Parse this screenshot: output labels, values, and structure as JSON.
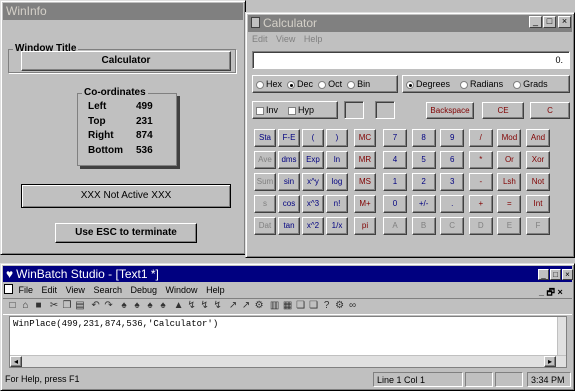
{
  "wininfo": {
    "title": "WinInfo",
    "window_title_label": "Window Title",
    "window_title_value": "Calculator",
    "coords_label": "Co-ordinates",
    "coords": [
      {
        "label": "Left",
        "value": "499"
      },
      {
        "label": "Top",
        "value": "231"
      },
      {
        "label": "Right",
        "value": "874"
      },
      {
        "label": "Bottom",
        "value": "536"
      }
    ],
    "status": "XXX Not Active XXX",
    "esc_button": "Use ESC to terminate"
  },
  "calculator": {
    "title": "Calculator",
    "menu": [
      "Edit",
      "View",
      "Help"
    ],
    "display_value": "0.",
    "base_options": [
      "Hex",
      "Dec",
      "Oct",
      "Bin"
    ],
    "base_selected": "Dec",
    "angle_options": [
      "Degrees",
      "Radians",
      "Grads"
    ],
    "angle_selected": "Degrees",
    "inv_label": "Inv",
    "hyp_label": "Hyp",
    "backspace": "Backspace",
    "ce": "CE",
    "c": "C",
    "sci_rows": [
      [
        "Sta",
        "F-E",
        "(",
        ")"
      ],
      [
        "Ave",
        "dms",
        "Exp",
        "ln"
      ],
      [
        "Sum",
        "sin",
        "x^y",
        "log"
      ],
      [
        "s",
        "cos",
        "x^3",
        "n!"
      ],
      [
        "Dat",
        "tan",
        "x^2",
        "1/x"
      ]
    ],
    "mem_keys": [
      "MC",
      "MR",
      "MS",
      "M+",
      "pi"
    ],
    "num_rows": [
      [
        "7",
        "8",
        "9",
        "/",
        "Mod",
        "And"
      ],
      [
        "4",
        "5",
        "6",
        "*",
        "Or",
        "Xor"
      ],
      [
        "1",
        "2",
        "3",
        "-",
        "Lsh",
        "Not"
      ],
      [
        "0",
        "+/-",
        ".",
        "+",
        "=",
        "Int"
      ],
      [
        "A",
        "B",
        "C",
        "D",
        "E",
        "F"
      ]
    ]
  },
  "winbatch": {
    "title": "WinBatch Studio - [Text1 *]",
    "menu": [
      "File",
      "Edit",
      "View",
      "Search",
      "Debug",
      "Window",
      "Help"
    ],
    "code_line": "WinPlace(499,231,874,536,'Calculator')",
    "status_help": "For Help, press F1",
    "status_position": "Line 1 Col 1",
    "status_time": "3:34 PM"
  }
}
